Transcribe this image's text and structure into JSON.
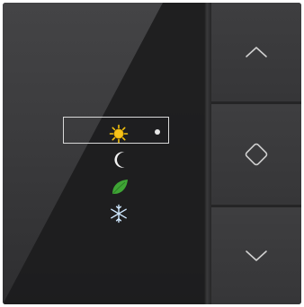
{
  "device": {
    "colors": {
      "body": "#2f2f30",
      "frame_highlight": "#d8d8d8",
      "icon_stroke": "#d0d0d0",
      "sun": "#f4c20d",
      "leaf": "#3fa535",
      "snow": "#cfe8ff"
    },
    "modes": [
      {
        "name": "sun-icon",
        "selected": true
      },
      {
        "name": "moon-icon",
        "selected": false
      },
      {
        "name": "leaf-icon",
        "selected": false
      },
      {
        "name": "snowflake-icon",
        "selected": false
      }
    ],
    "keys": [
      {
        "name": "chevron-up-icon"
      },
      {
        "name": "diamond-icon"
      },
      {
        "name": "chevron-down-icon"
      }
    ]
  }
}
